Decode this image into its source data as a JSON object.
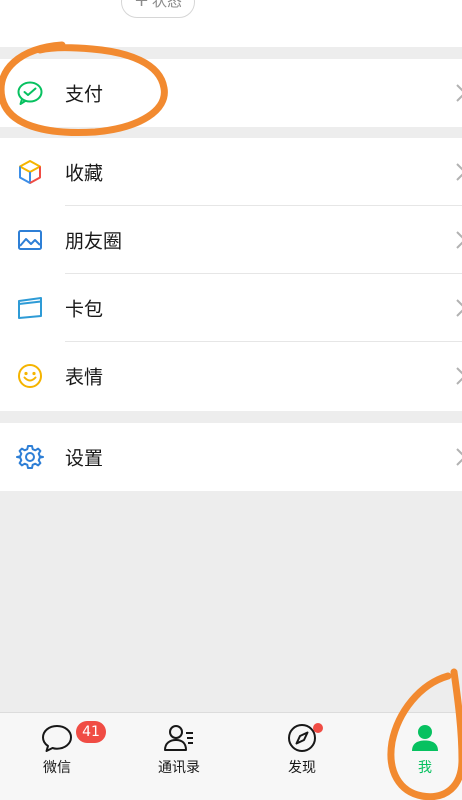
{
  "profile": {
    "status_label": "状态"
  },
  "menu": {
    "pay": {
      "label": "支付",
      "icon": "wechat-pay-icon"
    },
    "items": [
      {
        "label": "收藏",
        "icon": "favorites-cube-icon"
      },
      {
        "label": "朋友圈",
        "icon": "moments-picture-icon"
      },
      {
        "label": "卡包",
        "icon": "card-wallet-icon"
      },
      {
        "label": "表情",
        "icon": "sticker-smile-icon"
      }
    ],
    "settings": {
      "label": "设置",
      "icon": "gear-icon"
    }
  },
  "tabbar": {
    "tabs": [
      {
        "label": "微信",
        "badge": "41"
      },
      {
        "label": "通讯录"
      },
      {
        "label": "发现"
      },
      {
        "label": "我"
      }
    ]
  },
  "colors": {
    "accent": "#07c160",
    "badge": "#f04c44",
    "annotation": "#f28a30"
  }
}
